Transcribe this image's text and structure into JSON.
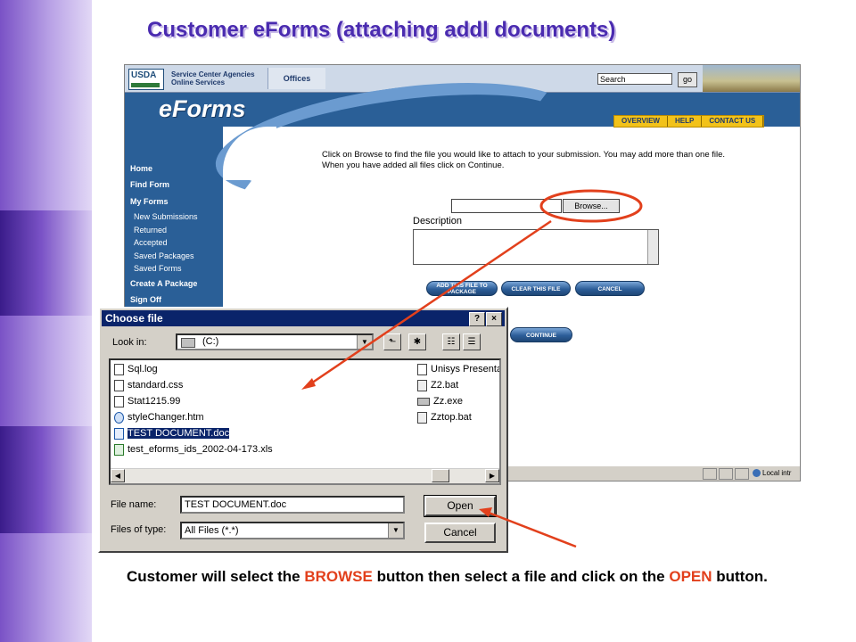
{
  "slide": {
    "title": "Customer eForms (attaching addl documents)",
    "caption": {
      "part1": "Customer will select the ",
      "highlight1": "BROWSE",
      "part2": " button then select a file and click on the ",
      "highlight2": "OPEN",
      "part3": " button."
    }
  },
  "browser": {
    "header": {
      "logo": "USDA",
      "agency_line1": "Service Center Agencies",
      "agency_line2": "Online Services",
      "offices_tab": "Offices",
      "search_value": "Search",
      "go_label": "go"
    },
    "banner": {
      "app_logo": "eForms",
      "nav_links": [
        "OVERVIEW",
        "HELP",
        "CONTACT US"
      ]
    },
    "sidebar": {
      "home": "Home",
      "find_form": "Find Form",
      "my_forms": "My Forms",
      "sub_items": [
        "New Submissions",
        "Returned",
        "Accepted",
        "Saved Packages",
        "Saved Forms"
      ],
      "create_package": "Create A Package",
      "sign_off": "Sign Off"
    },
    "main": {
      "instructions": "Click on Browse to find the file you would like to attach to your submission. You may add more than one file. When you have added all files click on Continue.",
      "browse_label": "Browse...",
      "description_label": "Description",
      "add_file_label": "ADD THIS FILE TO PACKAGE",
      "clear_file_label": "CLEAR THIS FILE",
      "cancel_label": "CANCEL",
      "continue_label": "CONTINUE"
    },
    "status": {
      "zone": "Local intr"
    }
  },
  "dialog": {
    "title": "Choose file",
    "help_btn": "?",
    "close_btn": "×",
    "look_in_label": "Look in:",
    "look_in_value": "(C:)",
    "files_left": [
      {
        "name": "Sql.log",
        "icon": "text-file-icon"
      },
      {
        "name": "standard.css",
        "icon": "css-file-icon"
      },
      {
        "name": "Stat1215.99",
        "icon": "data-file-icon"
      },
      {
        "name": "styleChanger.htm",
        "icon": "web-page-icon"
      },
      {
        "name": "TEST DOCUMENT.doc",
        "icon": "word-document-icon",
        "selected": true
      },
      {
        "name": "test_eforms_ids_2002-04-173.xls",
        "icon": "excel-file-icon"
      }
    ],
    "files_right": [
      {
        "name": "Unisys Presenta",
        "icon": "presentation-file-icon"
      },
      {
        "name": "Z2.bat",
        "icon": "batch-file-icon"
      },
      {
        "name": "Zz.exe",
        "icon": "executable-file-icon"
      },
      {
        "name": "Zztop.bat",
        "icon": "batch-file-icon"
      }
    ],
    "file_name_label": "File name:",
    "file_name_value": "TEST DOCUMENT.doc",
    "files_of_type_label": "Files of type:",
    "files_of_type_value": "All Files (*.*)",
    "open_label": "Open",
    "cancel_label": "Cancel"
  },
  "colors": {
    "title_purple": "#4a2bb0",
    "highlight_red": "#e2401c",
    "usda_blue": "#2a5f97",
    "nav_gold": "#f2c21a",
    "dialog_title_blue": "#0a246a"
  }
}
